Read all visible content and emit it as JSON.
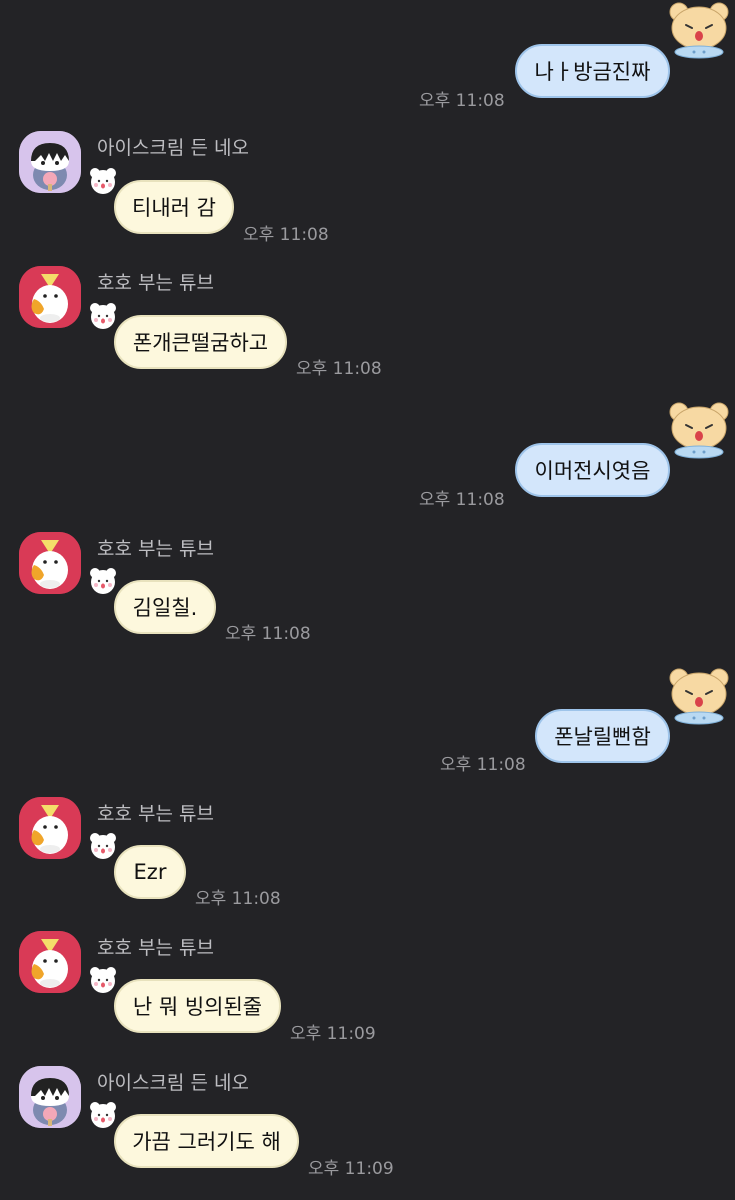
{
  "chat": {
    "messages": [
      {
        "id": "m1",
        "type": "sent",
        "text": "나ㅏ방금진짜",
        "time": "오후 11:08"
      },
      {
        "id": "m2",
        "type": "received",
        "sender": "아이스크림 든 네오",
        "text": "티내러 감",
        "time": "오후 11:08"
      },
      {
        "id": "m3",
        "type": "received",
        "sender": "호호 부는 튜브",
        "text": "폰개큰떨굼하고",
        "time": "오후 11:08"
      },
      {
        "id": "m4",
        "type": "sent",
        "text": "이머전시엿음",
        "time": "오후 11:08"
      },
      {
        "id": "m5",
        "type": "received",
        "sender": "호호 부는 튜브",
        "text": "김일칠.",
        "time": "오후 11:08"
      },
      {
        "id": "m6",
        "type": "sent",
        "text": "폰날릴뻔함",
        "time": "오후 11:08"
      },
      {
        "id": "m7",
        "type": "received",
        "sender": "호호 부는 튜브",
        "text": "Ezr",
        "time": "오후 11:08"
      },
      {
        "id": "m8",
        "type": "received",
        "sender": "호호 부는 튜브",
        "text": "난 뭐 빙의된줄",
        "time": "오후 11:09"
      },
      {
        "id": "m9",
        "type": "received",
        "sender": "아이스크림 든 네오",
        "text": "가끔 그러기도 해",
        "time": "오후 11:09"
      }
    ]
  },
  "icons": {
    "sent_profile": "bear-sticker-icon",
    "reaction": "white-bear-sticker-icon",
    "neo_avatar": "neo-avatar-icon",
    "tube_avatar": "tube-avatar-icon"
  },
  "colors": {
    "background": "#232326",
    "sent_bubble": "#d3e6fb",
    "received_bubble": "#fdf8dd",
    "time_text": "#9a9a9e",
    "name_text": "#bdbdc1"
  }
}
